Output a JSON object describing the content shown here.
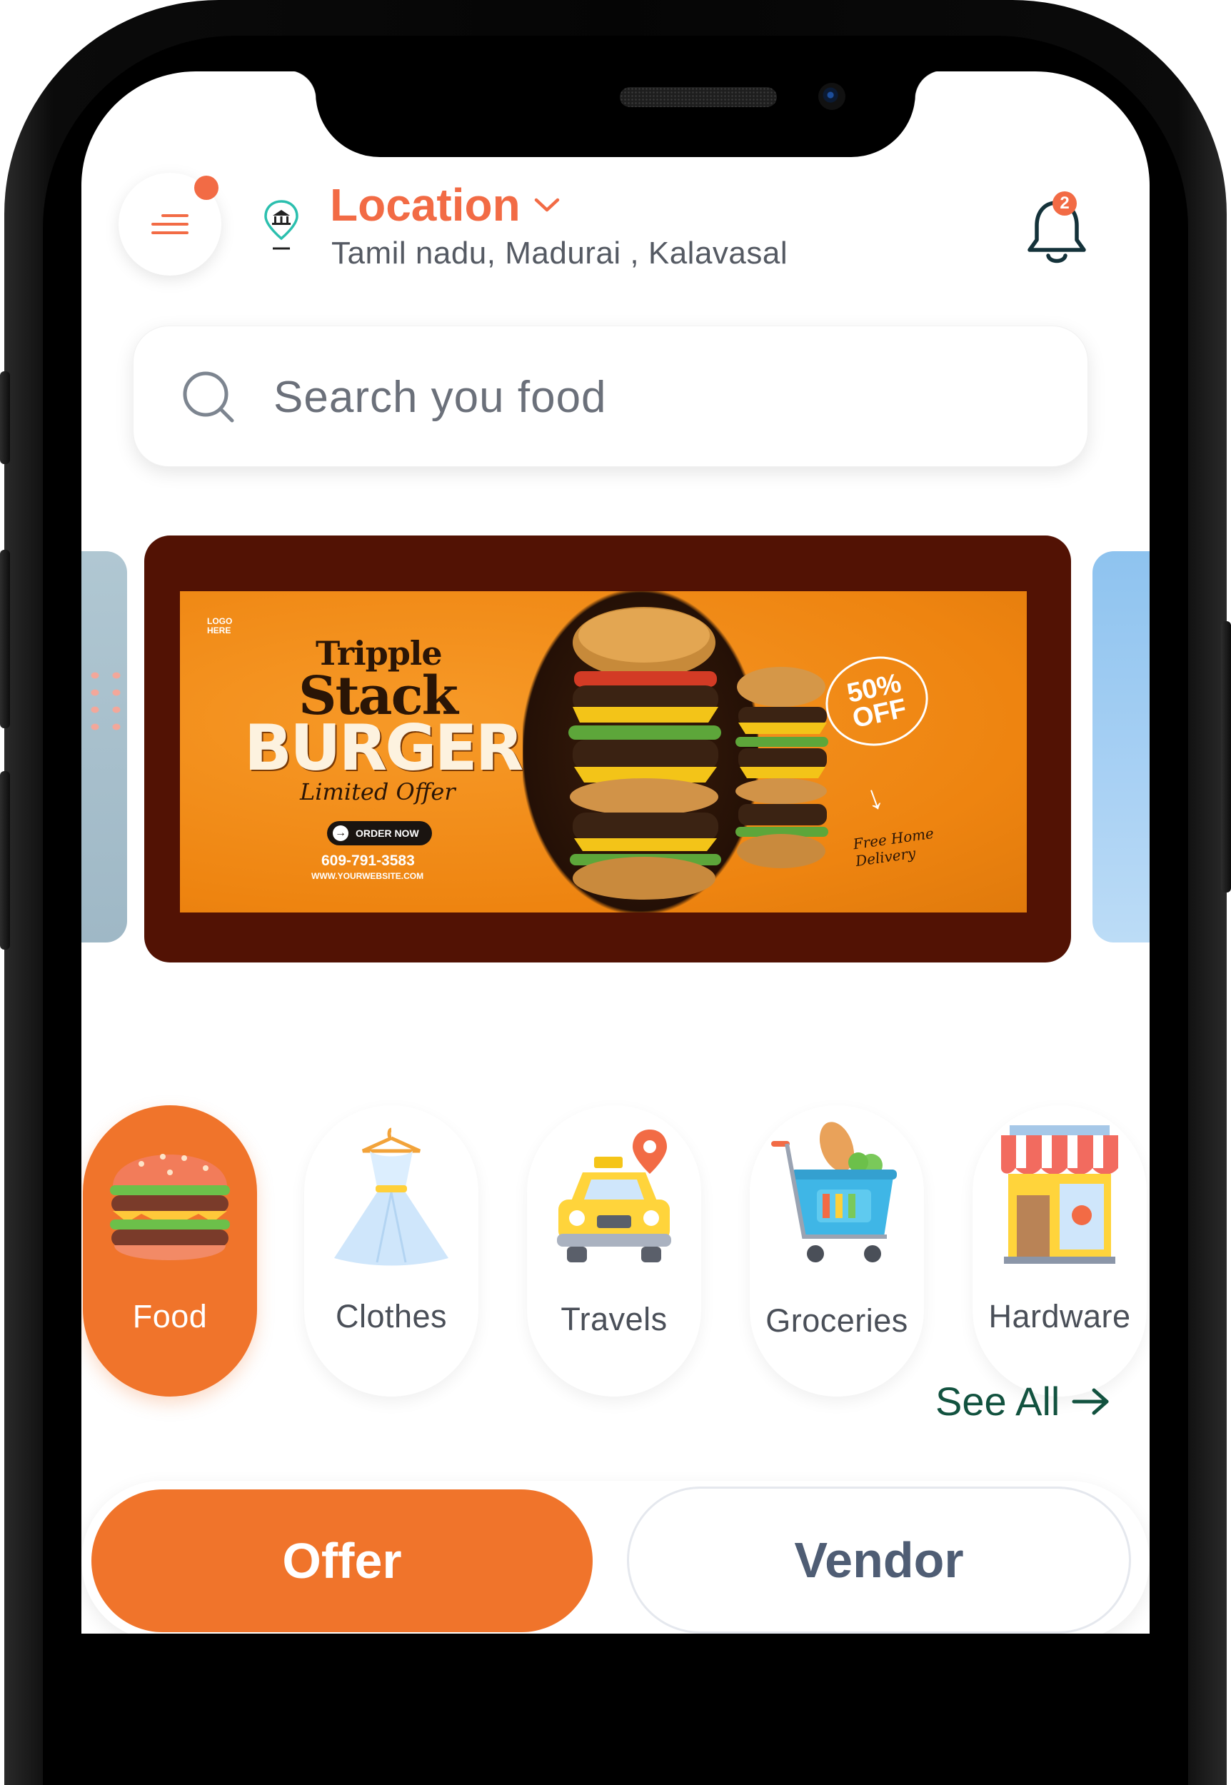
{
  "header": {
    "location_title": "Location",
    "location_subtitle": "Tamil nadu, Madurai , Kalavasal",
    "notification_count": "2"
  },
  "search": {
    "placeholder": "Search you food"
  },
  "banner": {
    "logo": "LOGO HERE",
    "line1": "Tripple",
    "line2": "Stack",
    "line3": "BURGER",
    "line4": "Limited Offer",
    "order_label": "ORDER NOW",
    "phone": "609-791-3583",
    "website": "WWW.YOURWEBSITE.COM",
    "discount": "50%",
    "discount_word": "OFF",
    "delivery": "Free Home Delivery"
  },
  "categories": [
    {
      "label": "Food",
      "icon": "burger-icon",
      "active": true
    },
    {
      "label": "Clothes",
      "icon": "dress-icon",
      "active": false
    },
    {
      "label": "Travels",
      "icon": "taxi-icon",
      "active": false
    },
    {
      "label": "Groceries",
      "icon": "grocery-basket-icon",
      "active": false
    },
    {
      "label": "Hardware",
      "icon": "store-icon",
      "active": false
    }
  ],
  "see_all_label": "See All",
  "tabs": {
    "offer": "Offer",
    "vendor": "Vendor",
    "selected": "Offer"
  },
  "colors": {
    "accent": "#f0742b",
    "banner_bg": "#521204",
    "see_all": "#12523f",
    "vendor_text": "#4f5d74"
  }
}
